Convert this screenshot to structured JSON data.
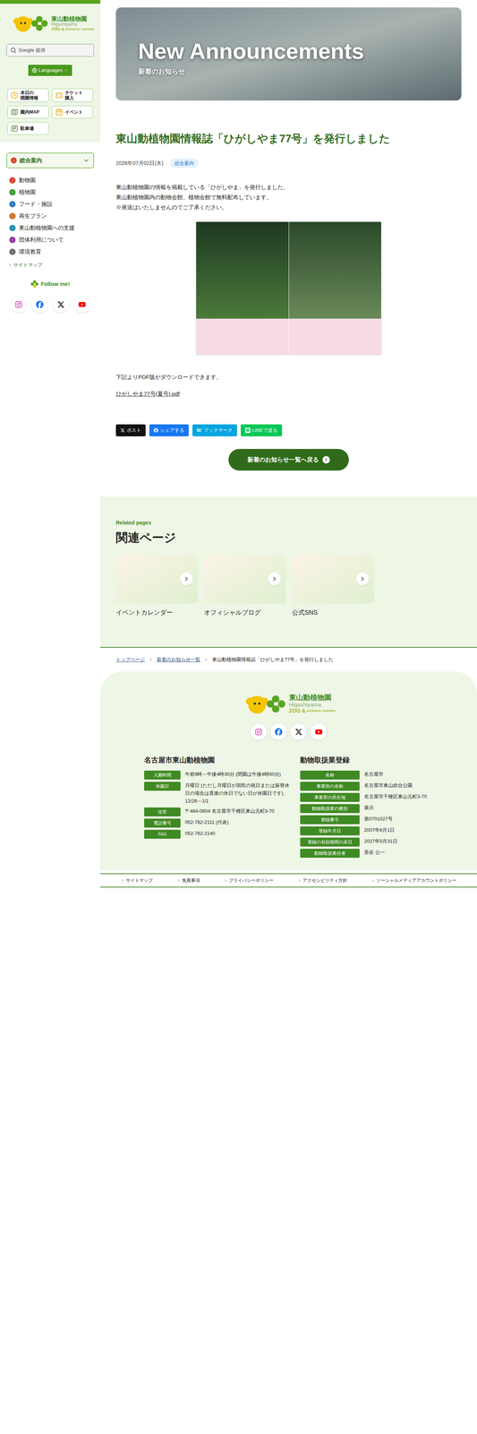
{
  "sidebar": {
    "logo": {
      "name": "東山動植物園",
      "romaji": "Higashiyama",
      "zoo": "ZOO &",
      "botanical": "BOTANICAL GARDENS"
    },
    "search": {
      "placeholder": "Google 提供"
    },
    "language_button": "Languages",
    "quick_links": [
      {
        "kind": "hours",
        "lines": [
          "本日の",
          "開園情報"
        ]
      },
      {
        "kind": "ticket",
        "lines": [
          "チケット",
          "購入"
        ]
      },
      {
        "kind": "map",
        "lines": [
          "園内MAP"
        ]
      },
      {
        "kind": "event",
        "lines": [
          "イベント"
        ]
      },
      {
        "kind": "parking",
        "lines": [
          "駐車場"
        ]
      }
    ],
    "menu_header": {
      "label": "総合案内",
      "expanded": false,
      "color": "#d9442f"
    },
    "menu": [
      {
        "label": "動物園",
        "color": "#d9442f"
      },
      {
        "label": "植物園",
        "color": "#3a9a3a"
      },
      {
        "label": "フード・施設",
        "color": "#2a78c0"
      },
      {
        "label": "再生プラン",
        "color": "#c8742a"
      },
      {
        "label": "東山動植物園への支援",
        "color": "#1f8fb0"
      },
      {
        "label": "団体利用について",
        "color": "#8a3aa0"
      },
      {
        "label": "環境教育",
        "color": "#6b6b6b"
      }
    ],
    "sitemap": "サイトマップ",
    "follow": "Follow me!"
  },
  "social": [
    {
      "kind": "instagram",
      "color": "#d6249f"
    },
    {
      "kind": "facebook",
      "color": "#1877f2"
    },
    {
      "kind": "x",
      "color": "#111111"
    },
    {
      "kind": "youtube",
      "color": "#ff0000"
    }
  ],
  "hero": {
    "title": "New Announcements",
    "subtitle": "新着のお知らせ"
  },
  "article": {
    "title": "東山動植物園情報誌「ひがしやま77号」を発行しました",
    "date": "2026年07月02日(木)",
    "tag": "総合案内",
    "body": [
      "東山動植物園の情報を掲載している「ひがしやま」を発行しました。",
      "東山動植物園内の動物会館、植物会館で無料配布しています。",
      "※発送はいたしませんのでご了承ください。"
    ],
    "download_text": "下記よりPDF版がダウンロードできます。",
    "pdf_link": "ひがしやま77号(夏号).pdf"
  },
  "share": [
    {
      "kind": "x",
      "label": "ポスト",
      "color": "#111111"
    },
    {
      "kind": "facebook",
      "label": "シェアする",
      "color": "#1877f2"
    },
    {
      "kind": "hatena",
      "icon": "B!",
      "label": "ブックマーク",
      "color": "#00a4de"
    },
    {
      "kind": "line",
      "label": "LINEで送る",
      "color": "#06c755"
    }
  ],
  "back_button": "新着のお知らせ一覧へ戻る",
  "related": {
    "eyebrow": "Related pages",
    "title": "関連ページ",
    "cards": [
      {
        "label": "イベントカレンダー"
      },
      {
        "label": "オフィシャルブログ"
      },
      {
        "label": "公式SNS"
      }
    ]
  },
  "breadcrumb": [
    "トップページ",
    "新着のお知らせ一覧",
    "東山動植物園情報誌「ひがしやま77号」を発行しました"
  ],
  "footer": {
    "left_title": "名古屋市東山動植物園",
    "left_rows": [
      {
        "label": "入園時間",
        "value": "午前9時～午後4時30分 (閉園は午後4時50分)"
      },
      {
        "label": "休園日",
        "value": "月曜日 (ただし月曜日が国民の祝日または振替休日の場合は直後の休日でない日が休園日です)、12/29～1/1"
      },
      {
        "label": "住所",
        "value": "〒464-0804 名古屋市千種区東山元町3-70"
      },
      {
        "label": "電話番号",
        "value": "052-782-2111 (代表)"
      },
      {
        "label": "FAX",
        "value": "052-782-2140"
      }
    ],
    "right_title": "動物取扱業登録",
    "right_rows": [
      {
        "label": "名称",
        "value": "名古屋市"
      },
      {
        "label": "事業所の名称",
        "value": "名古屋市東山総合公園"
      },
      {
        "label": "事業所の所在地",
        "value": "名古屋市千種区東山元町3-70"
      },
      {
        "label": "動物取扱業の種別",
        "value": "展示"
      },
      {
        "label": "登録番号",
        "value": "第0701027号"
      },
      {
        "label": "登録年月日",
        "value": "2007年6月1日"
      },
      {
        "label": "登録の有効期間の末日",
        "value": "2027年5月31日"
      },
      {
        "label": "動物取扱責任者",
        "value": "茶谷 公一"
      }
    ],
    "links": [
      "サイトマップ",
      "免責事項",
      "プライバシーポリシー",
      "アクセシビリティ方針",
      "ソーシャルメディアアカウントポリシー"
    ]
  }
}
